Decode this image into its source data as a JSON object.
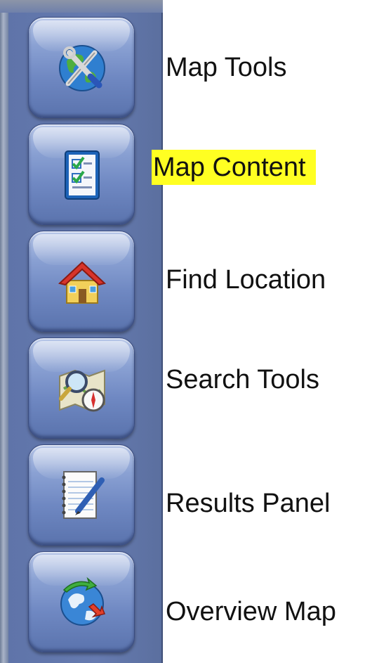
{
  "tools": [
    {
      "label": "Map Tools",
      "icon": "globe-wrench-icon",
      "highlighted": false
    },
    {
      "label": "Map Content",
      "icon": "checklist-icon",
      "highlighted": true
    },
    {
      "label": "Find Location",
      "icon": "house-icon",
      "highlighted": false
    },
    {
      "label": "Search Tools",
      "icon": "map-magnifier-compass-icon",
      "highlighted": false
    },
    {
      "label": "Results Panel",
      "icon": "notepad-pen-icon",
      "highlighted": false
    },
    {
      "label": "Overview Map",
      "icon": "globe-arrows-icon",
      "highlighted": false
    }
  ],
  "colors": {
    "panel": "#667bb0",
    "highlight": "#ffff22"
  }
}
